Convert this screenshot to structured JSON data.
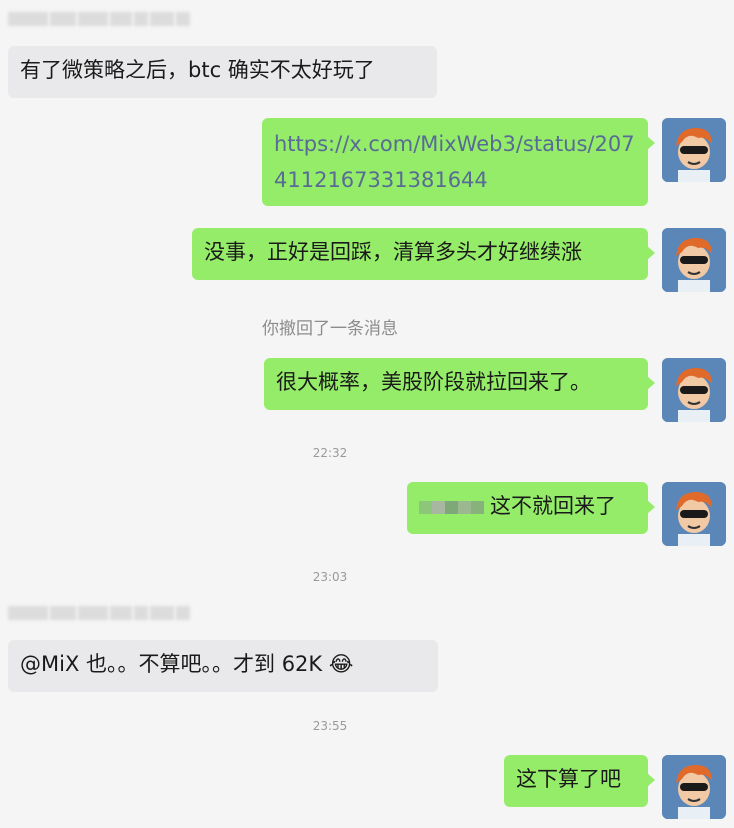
{
  "conversation": {
    "messages": [
      {
        "side": "left",
        "text": "有了微策略之后，btc 确实不太好玩了"
      },
      {
        "side": "right",
        "text": "https://x.com/MixWeb3/status/2074112167331381644",
        "link": true
      },
      {
        "side": "right",
        "text": "没事，正好是回踩，清算多头才好继续涨"
      },
      {
        "side": "right",
        "text": "很大概率，美股阶段就拉回来了。"
      },
      {
        "side": "right",
        "text": "这不就回来了"
      },
      {
        "side": "left",
        "text": "@MiX 也。。不算吧。。才到 62K 😂"
      },
      {
        "side": "right",
        "text": "这下算了吧"
      }
    ],
    "recall_notice": "你撤回了一条消息",
    "timestamps": [
      "22:32",
      "23:03",
      "23:55"
    ]
  },
  "icons": {
    "avatar": "user-avatar-icon",
    "emoji": "laughing-tears-emoji"
  },
  "colors": {
    "background": "#f5f5f5",
    "bubble_sent": "#95ec69",
    "bubble_received": "#e9e9eb",
    "link": "#576b95",
    "avatar_bg": "#5b86b8"
  }
}
